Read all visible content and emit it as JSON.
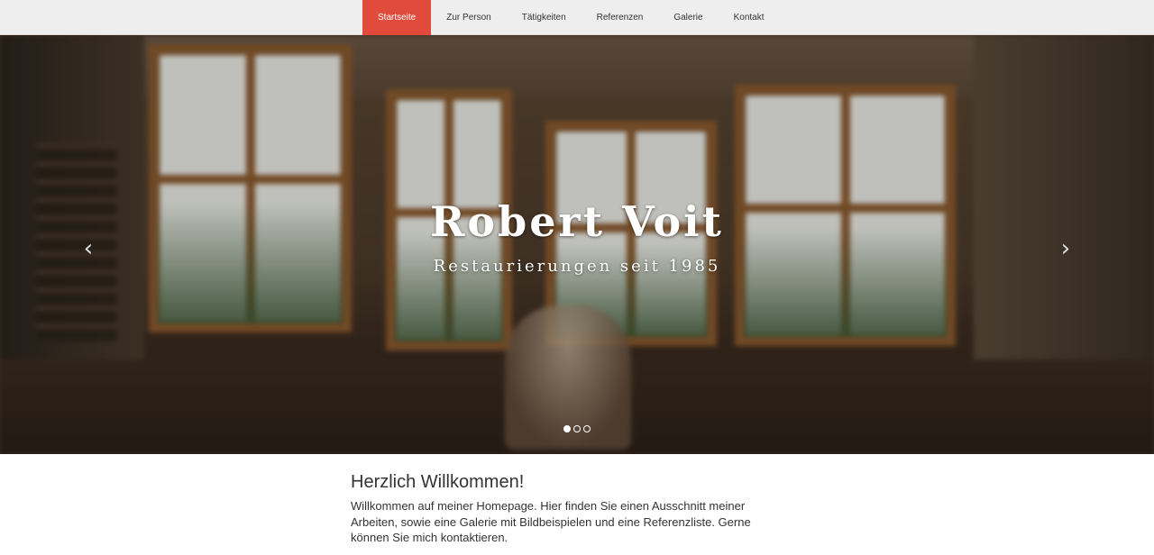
{
  "nav": {
    "items": [
      {
        "label": "Startseite",
        "active": true
      },
      {
        "label": "Zur Person",
        "active": false
      },
      {
        "label": "Tätigkeiten",
        "active": false
      },
      {
        "label": "Referenzen",
        "active": false
      },
      {
        "label": "Galerie",
        "active": false
      },
      {
        "label": "Kontakt",
        "active": false
      }
    ],
    "active_color": "#e04b3c"
  },
  "hero": {
    "title": "Robert Voit",
    "subtitle": "Restaurierungen seit 1985",
    "prev_icon": "chevron-left-icon",
    "next_icon": "chevron-right-icon",
    "slide_count": 3,
    "active_slide": 1
  },
  "content": {
    "heading": "Herzlich Willkommen!",
    "paragraph": "Willkommen auf meiner Homepage. Hier finden Sie einen Ausschnitt meiner Arbeiten, sowie eine Galerie mit Bildbeispielen und eine Referenzliste. Gerne können Sie mich kontaktieren."
  }
}
